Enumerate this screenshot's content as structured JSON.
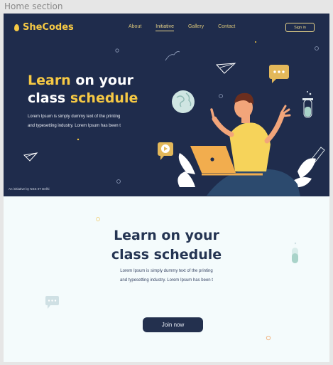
{
  "frame_label": "Home section",
  "brand": {
    "name": "SheCodes"
  },
  "nav": [
    "About",
    "Initiative",
    "Gallery",
    "Contact"
  ],
  "nav_active": "Initiative",
  "signin_label": "Sign in",
  "hero": {
    "title_white_1": "Learn",
    "title_yellow_1": " on your",
    "title_white_2": "class ",
    "title_yellow_2": "schedule",
    "desc_line1": "Lorem Ipsum is simply dummy text of the printing",
    "desc_line2": "and typesetting industry. Lorem Ipsum has been t",
    "initiative": "An initiative by NSS IIT Delhi"
  },
  "lower": {
    "title_line1": "Learn on your",
    "title_line2": "class schedule",
    "desc_line1": "Lorem Ipsum is simply dummy text of the printing",
    "desc_line2": "and typesetting industry. Lorem Ipsum has been t",
    "cta_label": "Join now"
  },
  "colors": {
    "navy": "#1f2c4c",
    "accent": "#f6c944",
    "light_bg": "#f4fbfc",
    "button": "#23304e"
  }
}
